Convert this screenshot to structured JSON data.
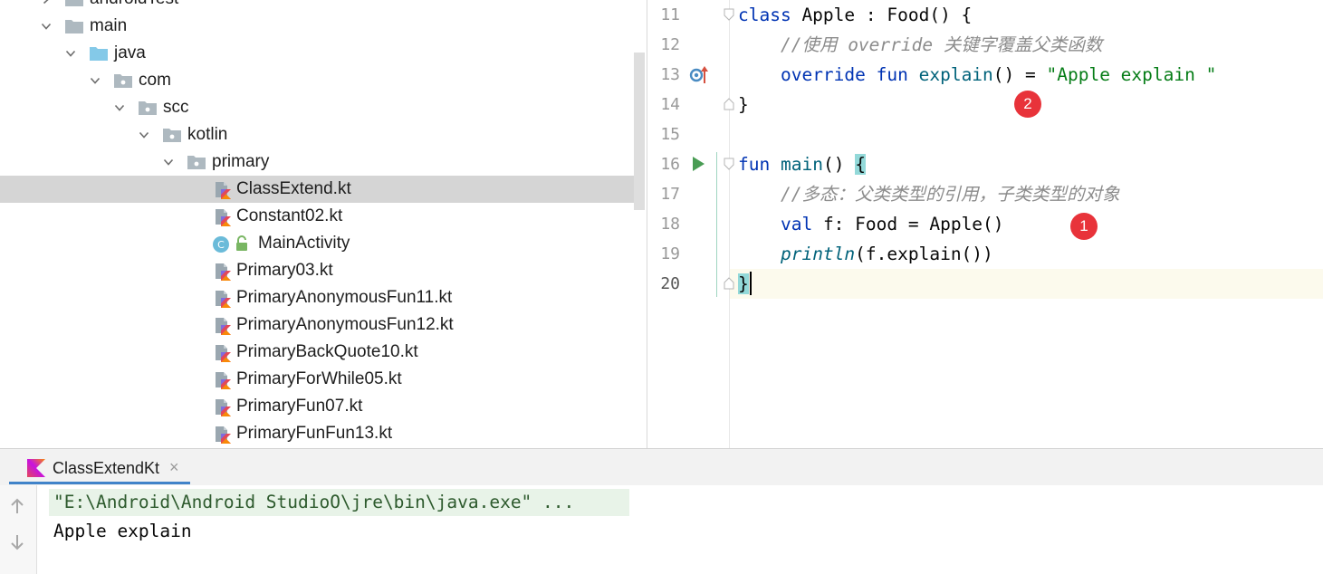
{
  "tree": {
    "items": [
      {
        "label": "androidTest",
        "type": "folder"
      },
      {
        "label": "main",
        "type": "folder"
      },
      {
        "label": "java",
        "type": "source-folder"
      },
      {
        "label": "com",
        "type": "package"
      },
      {
        "label": "scc",
        "type": "package"
      },
      {
        "label": "kotlin",
        "type": "package"
      },
      {
        "label": "primary",
        "type": "package"
      },
      {
        "label": "ClassExtend.kt",
        "type": "kotlin-file",
        "selected": true
      },
      {
        "label": "Constant02.kt",
        "type": "kotlin-file"
      },
      {
        "label": "MainActivity",
        "type": "activity-class"
      },
      {
        "label": "Primary03.kt",
        "type": "kotlin-file"
      },
      {
        "label": "PrimaryAnonymousFun11.kt",
        "type": "kotlin-file"
      },
      {
        "label": "PrimaryAnonymousFun12.kt",
        "type": "kotlin-file"
      },
      {
        "label": "PrimaryBackQuote10.kt",
        "type": "kotlin-file"
      },
      {
        "label": "PrimaryForWhile05.kt",
        "type": "kotlin-file"
      },
      {
        "label": "PrimaryFun07.kt",
        "type": "kotlin-file"
      },
      {
        "label": "PrimaryFunFun13.kt",
        "type": "kotlin-file"
      }
    ]
  },
  "editor": {
    "lines": [
      {
        "num": "11",
        "parts": [
          [
            "kw",
            "class"
          ],
          [
            "",
            " Apple : Food() {"
          ]
        ]
      },
      {
        "num": "12",
        "parts": [
          [
            "",
            "    "
          ],
          [
            "cmt",
            "//使用 override 关键字覆盖父类函数"
          ]
        ]
      },
      {
        "num": "13",
        "parts": [
          [
            "",
            "    "
          ],
          [
            "kw",
            "override fun"
          ],
          [
            "",
            " "
          ],
          [
            "fn",
            "explain"
          ],
          [
            "",
            "() = "
          ],
          [
            "str",
            "\"Apple explain \""
          ]
        ]
      },
      {
        "num": "14",
        "parts": [
          [
            "",
            "}"
          ]
        ]
      },
      {
        "num": "15",
        "parts": []
      },
      {
        "num": "16",
        "parts": [
          [
            "kw",
            "fun"
          ],
          [
            "",
            " "
          ],
          [
            "fn",
            "main"
          ],
          [
            "",
            "() "
          ],
          [
            "brace",
            "{"
          ]
        ]
      },
      {
        "num": "17",
        "parts": [
          [
            "",
            "    "
          ],
          [
            "cmt",
            "//多态：父类类型的引用，子类类型的对象"
          ]
        ]
      },
      {
        "num": "18",
        "parts": [
          [
            "",
            "    "
          ],
          [
            "kw",
            "val"
          ],
          [
            "",
            " f: Food = Apple()"
          ]
        ]
      },
      {
        "num": "19",
        "parts": [
          [
            "",
            "    "
          ],
          [
            "itfn",
            "println"
          ],
          [
            "",
            "(f.explain())"
          ]
        ]
      },
      {
        "num": "20",
        "parts": [
          [
            "brace",
            "}"
          ]
        ]
      }
    ],
    "badges": {
      "one": "1",
      "two": "2"
    }
  },
  "run": {
    "tab_label": "ClassExtendKt",
    "tab_close": "×",
    "command": "\"E:\\Android\\Android StudioO\\jre\\bin\\java.exe\" ...",
    "output": "Apple explain"
  },
  "colors": {
    "keyword": "#0033b3",
    "function": "#00627a",
    "string": "#067d17",
    "comment": "#8c8c8c",
    "badge": "#e8333a",
    "selection": "#d5d5d5"
  }
}
